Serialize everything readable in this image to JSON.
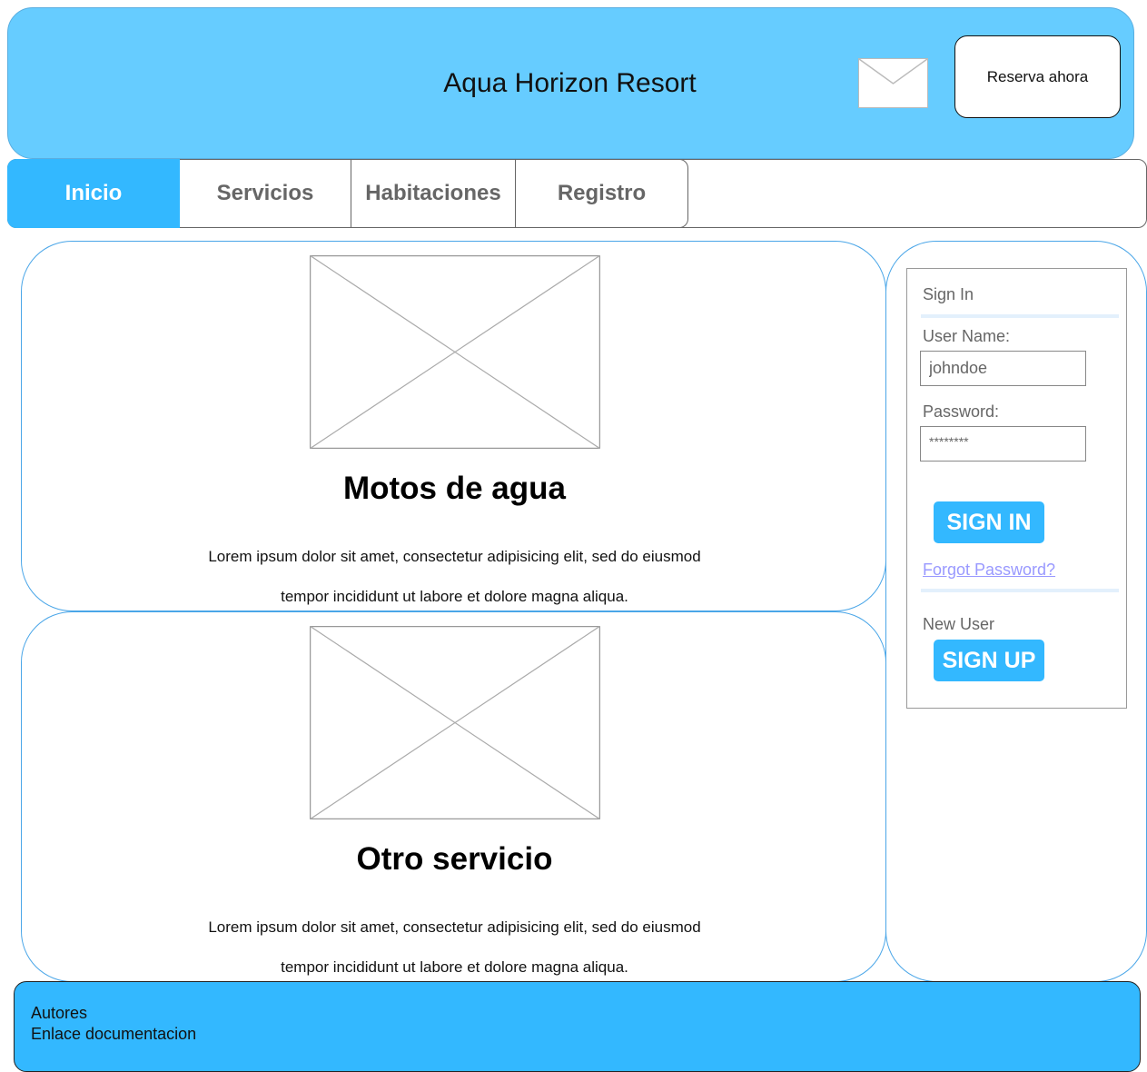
{
  "header": {
    "title": "Aqua Horizon Resort",
    "mail_icon": "envelope-icon",
    "reserve_label": "Reserva ahora"
  },
  "nav": {
    "tabs": [
      {
        "label": "Inicio",
        "active": true
      },
      {
        "label": "Servicios",
        "active": false
      },
      {
        "label": "Habitaciones",
        "active": false
      },
      {
        "label": "Registro",
        "active": false
      }
    ]
  },
  "cards": [
    {
      "title": "Motos de agua",
      "text_line1": "Lorem ipsum dolor sit amet, consectetur adipisicing elit, sed do eiusmod",
      "text_line2": "tempor incididunt ut labore et dolore magna aliqua."
    },
    {
      "title": "Otro servicio",
      "text_line1": "Lorem ipsum dolor sit amet, consectetur adipisicing elit, sed do eiusmod",
      "text_line2": "tempor incididunt ut labore et dolore magna aliqua."
    }
  ],
  "signin": {
    "heading": "Sign In",
    "username_label": "User Name:",
    "username_value": "johndoe",
    "password_label": "Password:",
    "password_value": "********",
    "signin_button": "SIGN IN",
    "forgot_link": "Forgot Password?",
    "new_user_label": "New User",
    "signup_button": "SIGN UP"
  },
  "footer": {
    "line1": "Autores",
    "line2": "Enlace documentacion"
  },
  "colors": {
    "header_bg": "#66ccff",
    "accent": "#33b8ff",
    "card_border": "#4aa6e8",
    "link": "#9999ff"
  }
}
